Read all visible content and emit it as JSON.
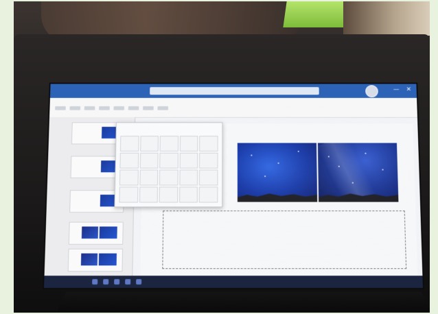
{
  "colors": {
    "border": "#e9f2df",
    "titlebar": "#2d63b7",
    "screen_bg": "#f2f3f6",
    "night_sky": "#1537a8"
  },
  "icons": [
    "avatar-icon",
    "minimize-icon",
    "close-icon",
    "windows-start-icon"
  ]
}
